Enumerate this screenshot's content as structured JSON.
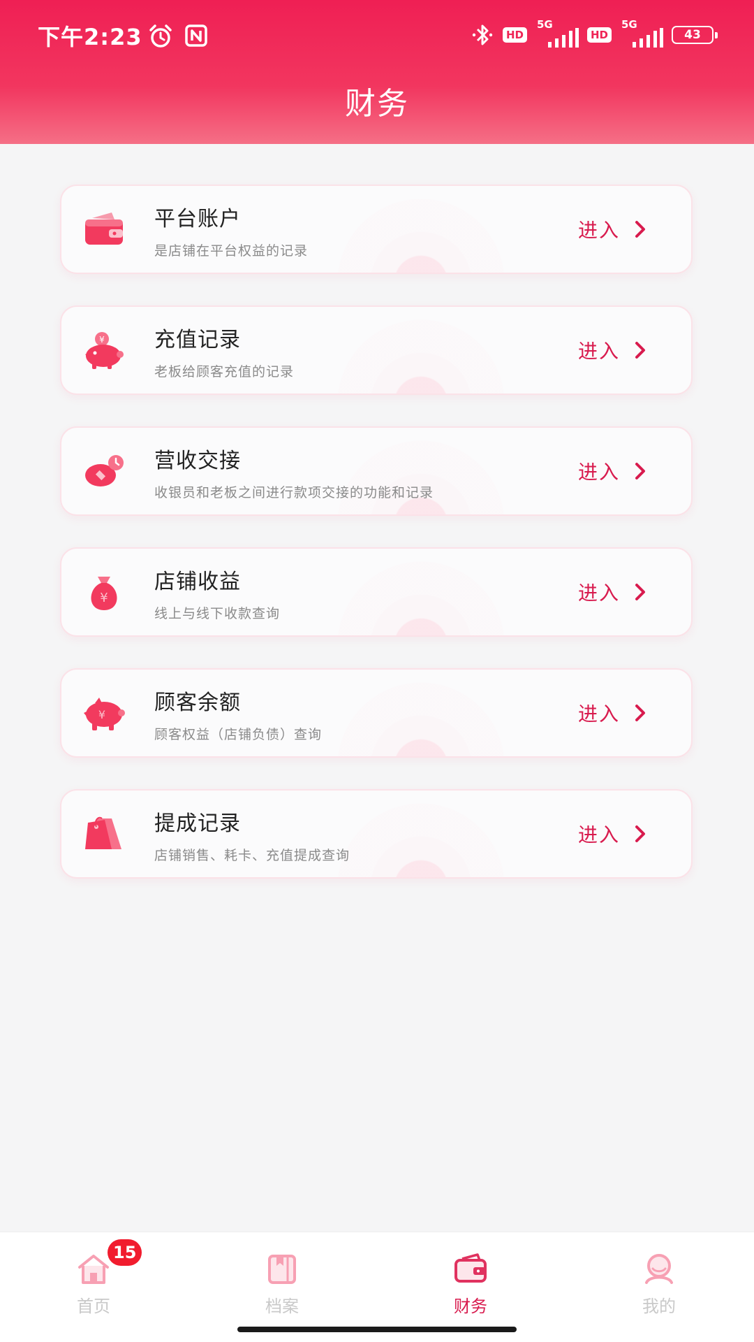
{
  "status_bar": {
    "time": "下午2:23",
    "hd_1": "HD",
    "net_1": "5G",
    "hd_2": "HD",
    "net_2": "5G",
    "battery": "43",
    "icons": [
      "alarm-icon",
      "nfc-icon",
      "bluetooth-icon",
      "signal-icon",
      "battery-icon"
    ]
  },
  "header": {
    "title": "财务"
  },
  "colors": {
    "header_top": "#ef1f54",
    "header_bottom": "#f56f86",
    "accent": "#d81b4e",
    "badge": "#f11c2e",
    "background": "#f5f5f6"
  },
  "cards": [
    {
      "title": "平台账户",
      "subtitle": "是店铺在平台权益的记录",
      "action": "进入",
      "icon": "wallet-icon"
    },
    {
      "title": "充值记录",
      "subtitle": "老板给顾客充值的记录",
      "action": "进入",
      "icon": "piggy-bank-coin-icon"
    },
    {
      "title": "营收交接",
      "subtitle": "收银员和老板之间进行款项交接的功能和记录",
      "action": "进入",
      "icon": "coin-exchange-icon"
    },
    {
      "title": "店铺收益",
      "subtitle": "线上与线下收款查询",
      "action": "进入",
      "icon": "money-bag-icon"
    },
    {
      "title": "顾客余额",
      "subtitle": "顾客权益（店铺负债）查询",
      "action": "进入",
      "icon": "piggy-bank-icon"
    },
    {
      "title": "提成记录",
      "subtitle": "店铺销售、耗卡、充值提成查询",
      "action": "进入",
      "icon": "price-tag-icon"
    }
  ],
  "bottom_nav": {
    "items": [
      {
        "label": "首页",
        "icon": "home-icon",
        "badge": "15",
        "active": false
      },
      {
        "label": "档案",
        "icon": "archive-icon",
        "active": false
      },
      {
        "label": "财务",
        "icon": "wallet-icon",
        "active": true
      },
      {
        "label": "我的",
        "icon": "profile-icon",
        "active": false
      }
    ]
  }
}
